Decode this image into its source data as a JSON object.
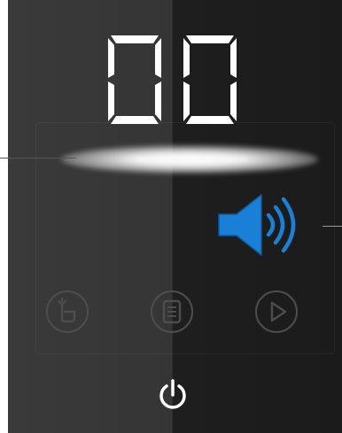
{
  "display": {
    "digits": "00"
  },
  "icons": {
    "volume": "speaker-volume-icon",
    "function": "hand-touch-icon",
    "program": "program-list-icon",
    "start": "play-icon",
    "power": "power-icon"
  },
  "colors": {
    "panel_left": "#3a3a3a",
    "panel_right": "#1b1b1b",
    "digits": "#ffffff",
    "speaker": "#1a7fd6"
  }
}
